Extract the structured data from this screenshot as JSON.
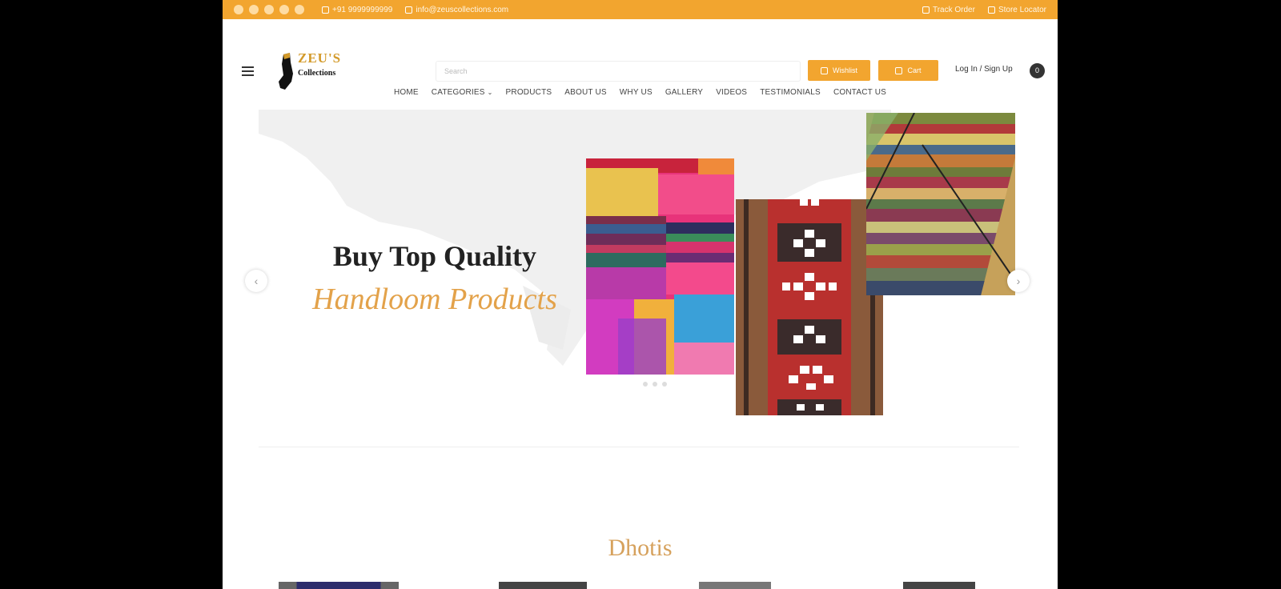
{
  "topbar": {
    "socials": [
      "facebook-icon",
      "twitter-icon",
      "instagram-icon",
      "youtube-icon",
      "linkedin-icon"
    ],
    "phone": "+91 9999999999",
    "email": "info@zeuscollections.com",
    "link1": "Track Order",
    "link2": "Store Locator"
  },
  "header": {
    "logo_title": "ZEU'S",
    "logo_subtitle": "Collections",
    "search_placeholder": "Search",
    "wishlist_label": "Wishlist",
    "cart_label": "Cart",
    "login_label": "Log In / Sign Up",
    "user_badge": "0"
  },
  "nav": {
    "items": [
      "HOME",
      "CATEGORIES",
      "PRODUCTS",
      "ABOUT US",
      "WHY US",
      "GALLERY",
      "VIDEOS",
      "TESTIMONIALS",
      "CONTACT US"
    ]
  },
  "hero": {
    "line1": "Buy Top Quality",
    "line2": "Handloom Products"
  },
  "section": {
    "title": "Dhotis"
  },
  "colors": {
    "accent": "#f2a52f",
    "gold_text": "#d6a15c"
  }
}
